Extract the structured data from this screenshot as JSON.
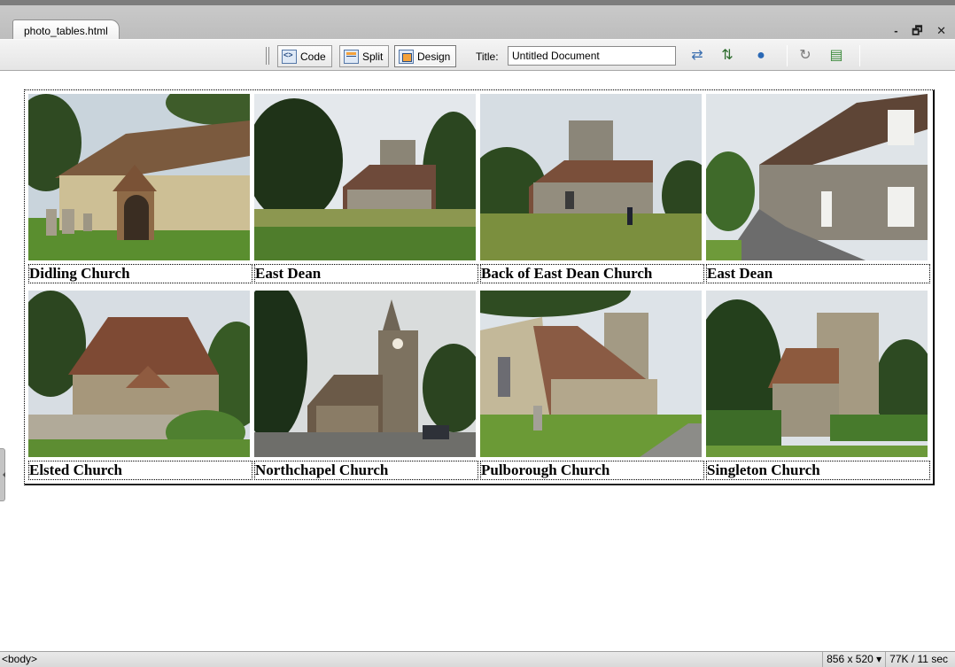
{
  "document": {
    "tab_label": "photo_tables.html"
  },
  "window_controls": {
    "minimize": "-",
    "restore": "🗗",
    "close": "✕"
  },
  "toolbar": {
    "views": [
      {
        "label": "Code",
        "icon": "code-view-icon"
      },
      {
        "label": "Split",
        "icon": "split-view-icon"
      },
      {
        "label": "Design",
        "icon": "design-view-icon",
        "active": true
      }
    ],
    "title_label": "Title:",
    "title_value": "Untitled Document",
    "icons": [
      "file-management-icon",
      "validate-icon",
      "preview-browser-icon",
      "refresh-icon",
      "view-options-icon"
    ]
  },
  "photos": [
    {
      "caption": "Didling Church",
      "scene": "barn"
    },
    {
      "caption": "East Dean",
      "scene": "distant"
    },
    {
      "caption": "Back of East Dean Church",
      "scene": "tower"
    },
    {
      "caption": "East Dean",
      "scene": "cottages"
    },
    {
      "caption": "Elsted Church",
      "scene": "flint"
    },
    {
      "caption": "Northchapel Church",
      "scene": "spire"
    },
    {
      "caption": "Pulborough Church",
      "scene": "pulborough"
    },
    {
      "caption": "Singleton Church",
      "scene": "singleton"
    }
  ],
  "statusbar": {
    "tag": "<body>",
    "dimensions": "856 x 520 ▾",
    "download": "77K / 11 sec"
  }
}
